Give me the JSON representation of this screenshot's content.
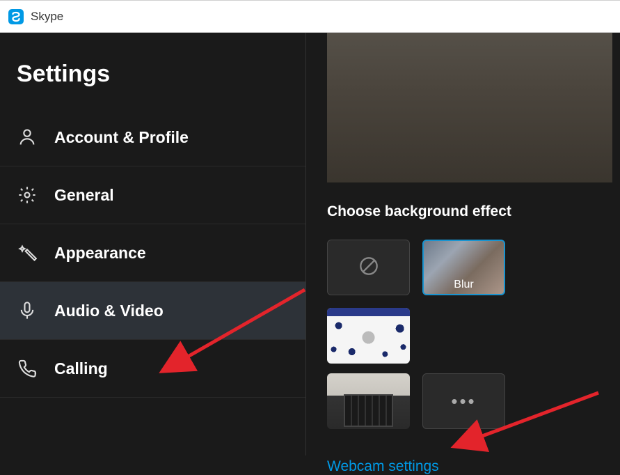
{
  "titlebar": {
    "app_name": "Skype"
  },
  "sidebar": {
    "title": "Settings",
    "items": [
      {
        "label": "Account & Profile",
        "icon": "person-icon",
        "selected": false
      },
      {
        "label": "General",
        "icon": "gear-icon",
        "selected": false
      },
      {
        "label": "Appearance",
        "icon": "wand-icon",
        "selected": false
      },
      {
        "label": "Audio & Video",
        "icon": "microphone-icon",
        "selected": true
      },
      {
        "label": "Calling",
        "icon": "phone-icon",
        "selected": false
      }
    ]
  },
  "content": {
    "bg_effect_title": "Choose background effect",
    "effects": {
      "none": {
        "name": "none"
      },
      "blur": {
        "label": "Blur",
        "selected": true
      },
      "pattern": {
        "name": "pattern"
      },
      "room": {
        "name": "room"
      },
      "more": {
        "name": "more"
      }
    },
    "webcam_link": "Webcam settings"
  },
  "colors": {
    "accent": "#0099e5",
    "arrow": "#e3242b"
  }
}
